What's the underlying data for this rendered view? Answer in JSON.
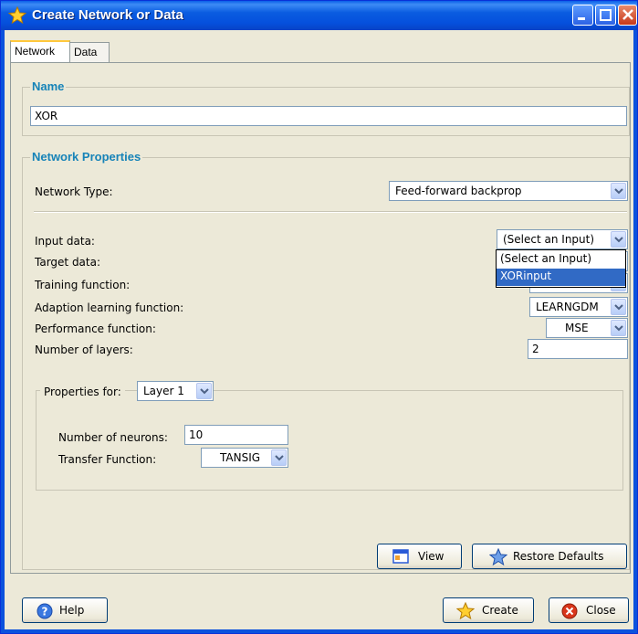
{
  "window": {
    "title": "Create Network or Data",
    "accent": "#0a5ce0"
  },
  "tabs": [
    {
      "label": "Network",
      "active": true
    },
    {
      "label": "Data",
      "active": false
    }
  ],
  "name_group": {
    "title": "Name",
    "value": "XOR"
  },
  "props_group": {
    "title": "Network Properties",
    "network_type_label": "Network Type:",
    "network_type_value": "Feed-forward backprop",
    "input_label": "Input data:",
    "input_value": "(Select an Input)",
    "target_label": "Target data:",
    "training_label": "Training function:",
    "adaption_label": "Adaption learning function:",
    "adaption_value": "LEARNGDM",
    "performance_label": "Performance function:",
    "performance_value": "MSE",
    "layers_label": "Number of layers:",
    "layers_value": "2"
  },
  "dropdown": {
    "options": [
      "(Select an Input)",
      "XORinput"
    ],
    "highlighted": "XORinput"
  },
  "layer_group": {
    "properties_for_label": "Properties for:",
    "layer_value": "Layer 1",
    "neurons_label": "Number of neurons:",
    "neurons_value": "10",
    "transfer_label": "Transfer Function:",
    "transfer_value": "TANSIG"
  },
  "buttons": {
    "view": "View",
    "restore": "Restore Defaults",
    "help": "Help",
    "create": "Create",
    "close": "Close"
  }
}
